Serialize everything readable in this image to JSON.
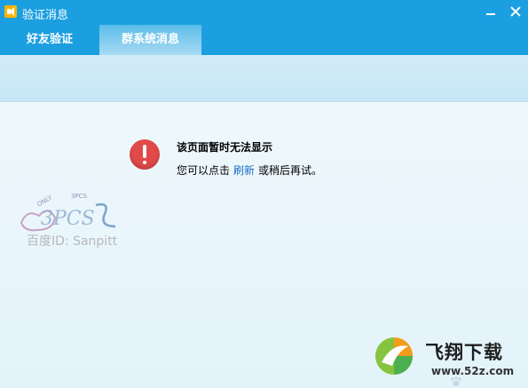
{
  "window": {
    "title": "验证消息",
    "icon": "speaker-icon",
    "controls": [
      "minimize-icon",
      "close-icon"
    ]
  },
  "tabs": [
    {
      "label": "好友验证",
      "active": false
    },
    {
      "label": "群系统消息",
      "active": true
    }
  ],
  "error": {
    "icon": "error-icon",
    "title": "该页面暂时无法显示",
    "message_before": "您可以点击",
    "link_label": "刷新",
    "message_after": "或稍后再试。"
  },
  "watermark": {
    "small_words": [
      "ONLY",
      "3PCS"
    ],
    "logo_text": "3PCS",
    "caption": "百度ID: Sanpitt"
  },
  "site_logo": {
    "name": "飞翔下载",
    "url": "www.52z.com"
  },
  "colors": {
    "titlebar": "#1c9fe1",
    "band": "#cde9f6",
    "error": "#e24a4a",
    "link": "#1a6fc2"
  }
}
